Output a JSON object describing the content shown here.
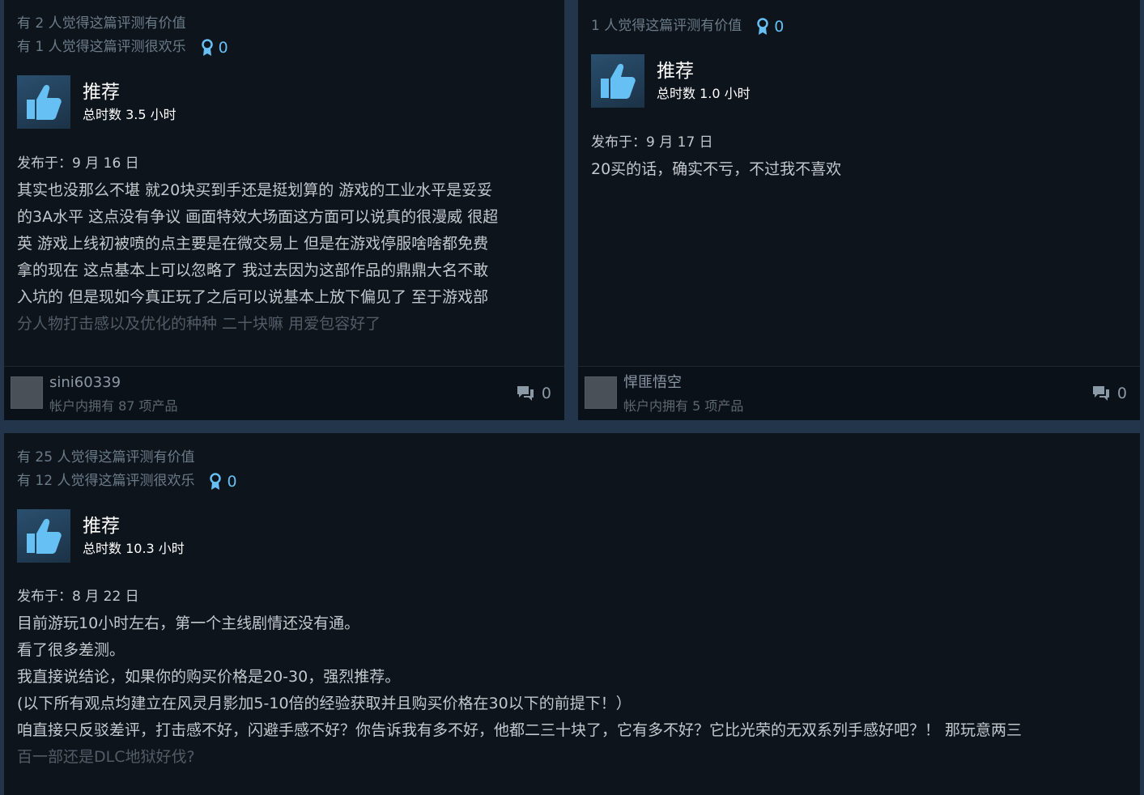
{
  "reviews": [
    {
      "helpful": "有 2 人觉得这篇评测有价值",
      "funny": "有 1 人觉得这篇评测很欢乐",
      "awards": "0",
      "recommendation": "推荐",
      "hours": "总时数 3.5 小时",
      "posted": "发布于：9 月 16 日",
      "text_lines": [
        "其实也没那么不堪 就20块买到手还是挺划算的 游戏的工业水平是妥妥",
        "的3A水平 这点没有争议 画面特效大场面这方面可以说真的很漫威 很超",
        "英 游戏上线初被喷的点主要是在微交易上 但是在游戏停服啥啥都免费",
        "拿的现在 这点基本上可以忽略了 我过去因为这部作品的鼎鼎大名不敢",
        "入坑的 但是现如今真正玩了之后可以说基本上放下偏见了 至于游戏部"
      ],
      "faded_line": "分人物打击感以及优化的种种 二十块嘛 用爱包容好了",
      "username": "sini60339",
      "products": "帐户内拥有 87 项产品",
      "comments": "0"
    },
    {
      "helpful": "1 人觉得这篇评测有价值",
      "awards": "0",
      "recommendation": "推荐",
      "hours": "总时数 1.0 小时",
      "posted": "发布于：9 月 17 日",
      "text_lines": [
        "20买的话，确实不亏，不过我不喜欢"
      ],
      "username": "悍匪悟空",
      "products": "帐户内拥有 5 项产品",
      "comments": "0"
    },
    {
      "helpful": "有 25 人觉得这篇评测有价值",
      "funny": "有 12 人觉得这篇评测很欢乐",
      "awards": "0",
      "recommendation": "推荐",
      "hours": "总时数 10.3 小时",
      "posted": "发布于：8 月 22 日",
      "text_lines": [
        "目前游玩10小时左右，第一个主线剧情还没有通。",
        "看了很多差测。",
        "我直接说结论，如果你的购买价格是20-30，强烈推荐。",
        "(以下所有观点均建立在风灵月影加5-10倍的经验获取并且购买价格在30以下的前提下！）",
        "咱直接只反驳差评，打击感不好，闪避手感不好？你告诉我有多不好，他都二三十块了，它有多不好？它比光荣的无双系列手感好吧？！ 那玩意两三"
      ],
      "faded_line": "百一部还是DLC地狱好伐?"
    }
  ],
  "colors": {
    "card_bg": "#0e141c",
    "award": "#66c0f4",
    "page_bg": "#22354a"
  }
}
